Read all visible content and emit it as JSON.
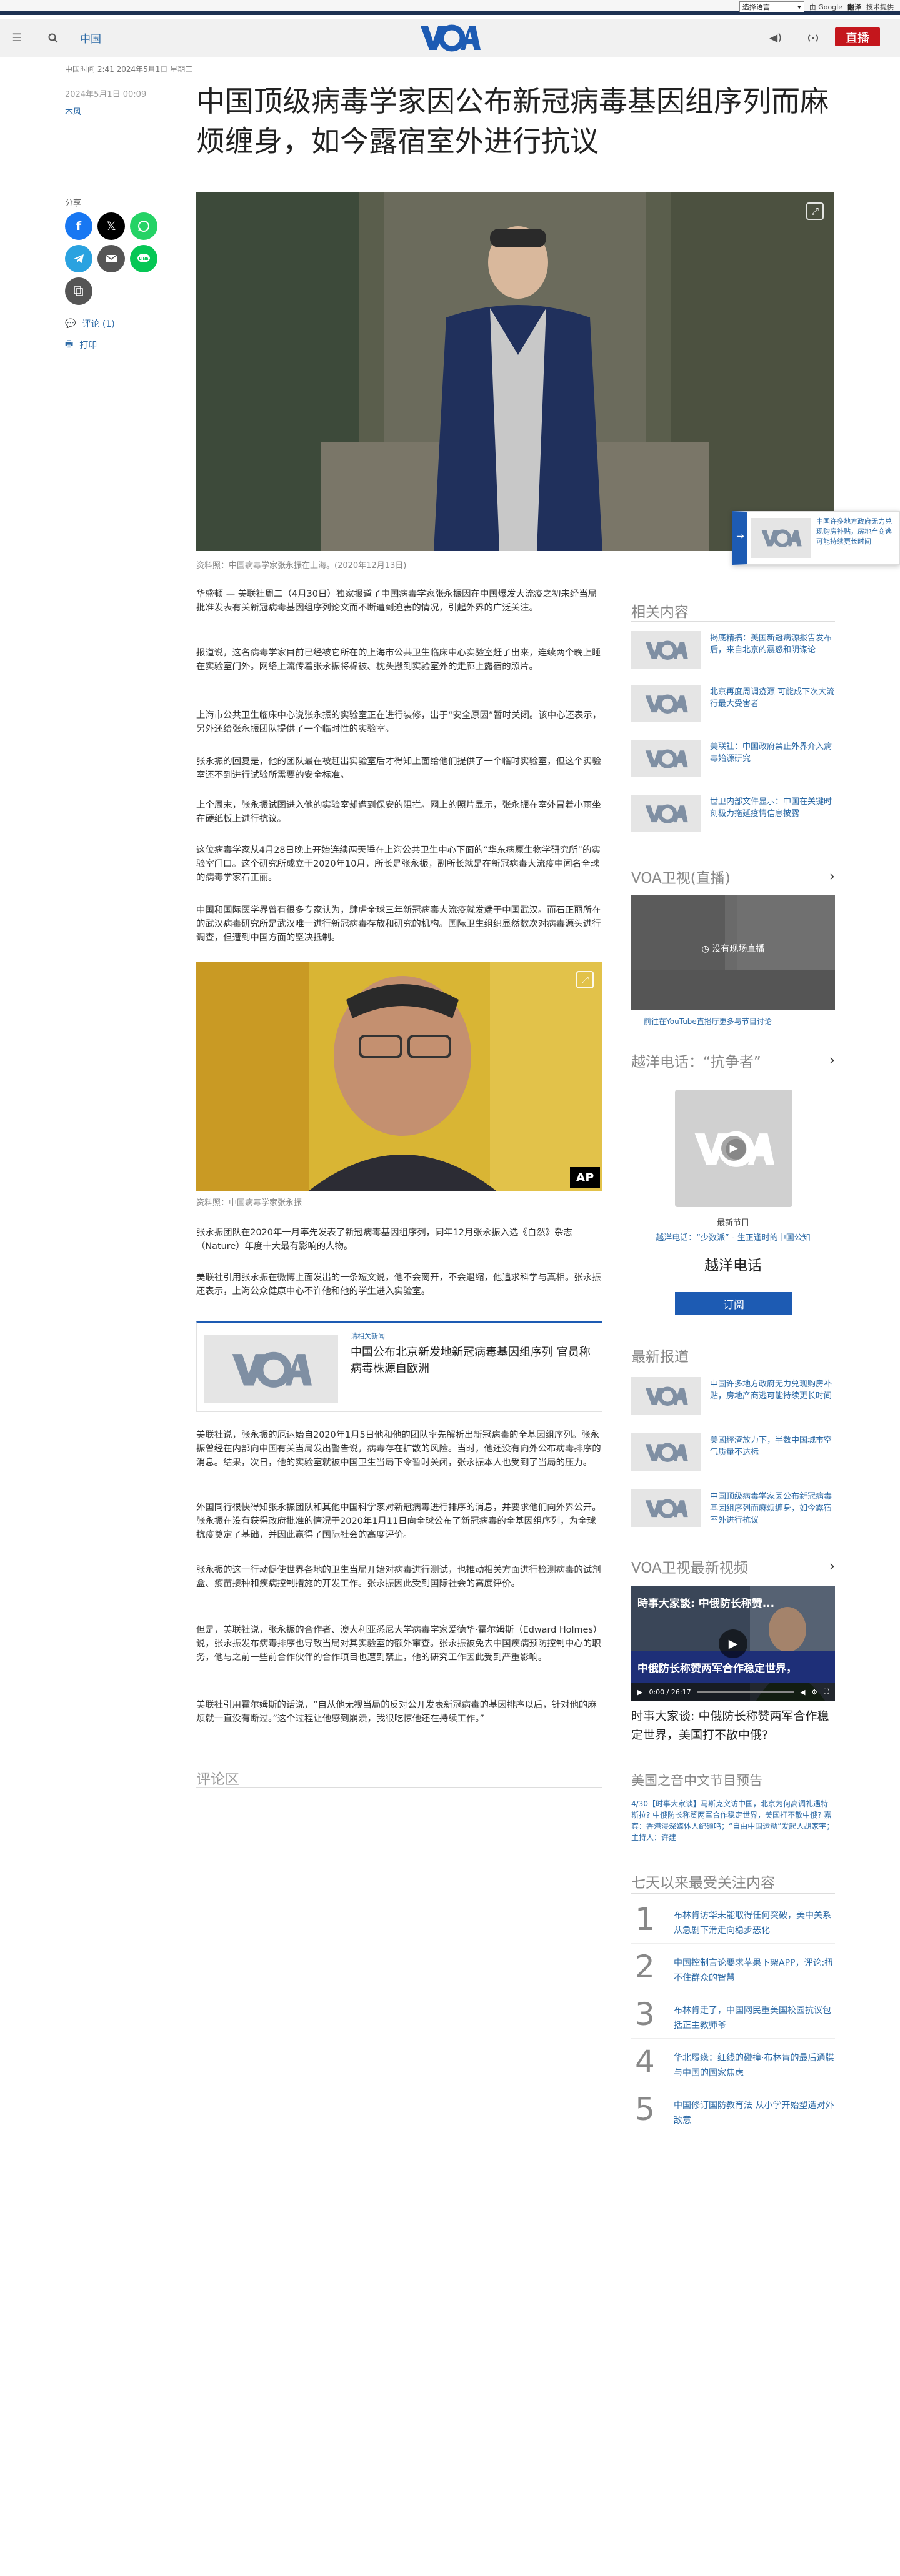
{
  "translate": {
    "select_label": "选择语言",
    "powered_by": "由 Google",
    "translate_word": "翻译",
    "provider": "技术提供"
  },
  "header": {
    "section": "中国",
    "logo_text": "VOA",
    "live_label": "直播",
    "icons": [
      "menu-icon",
      "search-icon",
      "volume-icon",
      "radio-icon"
    ]
  },
  "article": {
    "updated": "中国时间 2:41 2024年5月1日 星期三",
    "date": "2024年5月1日 00:09",
    "author": "木风",
    "title": "中国顶级病毒学家因公布新冠病毒基因组序列而麻烦缠身，如今露宿室外进行抗议",
    "share_label": "分享",
    "comments_link": "评论 (1)",
    "print_link": "打印",
    "photo1_caption": "资料照：中国病毒学家张永振在上海。(2020年12月13日)",
    "photo2_caption": "资料照：中国病毒学家张永振",
    "photo2_badge": "AP",
    "paragraphs_a": [
      "华盛顿 — 美联社周二（4月30日）独家报道了中国病毒学家张永振因在中国爆发大流疫之初未经当局批准发表有关新冠病毒基因组序列论文而不断遭到迫害的情况，引起外界的广泛关注。",
      "报道说，这名病毒学家目前已经被它所在的上海市公共卫生临床中心实验室赶了出来，连续两个晚上睡在实验室门外。网络上流传着张永振将棉被、枕头搬到实验室外的走廊上露宿的照片。",
      "上海市公共卫生临床中心说张永振的实验室正在进行装修，出于“安全原因”暂时关闭。该中心还表示，另外还给张永振团队提供了一个临时性的实验室。",
      "张永振的回复是，他的团队最在被赶出实验室后才得知上面给他们提供了一个临时实验室，但这个实验室还不到进行试验所需要的安全标准。",
      "上个周末，张永振试图进入他的实验室却遭到保安的阻拦。网上的照片显示，张永振在室外冒着小雨坐在硬纸板上进行抗议。",
      "这位病毒学家从4月28日晚上开始连续两天睡在上海公共卫生中心下面的“华东病原生物学研究所”的实验室门口。这个研究所成立于2020年10月，所长是张永振，副所长就是在新冠病毒大流疫中闻名全球的病毒学家石正丽。",
      "中国和国际医学界曾有很多专家认为，肆虐全球三年新冠病毒大流疫就发端于中国武汉。而石正丽所在的武汉病毒研究所是武汉唯一进行新冠病毒存放和研究的机构。国际卫生组织显然数次对病毒源头进行调查，但遭到中国方面的坚决抵制。"
    ],
    "paragraphs_b": [
      "张永振团队在2020年一月率先发表了新冠病毒基因组序列，同年12月张永振入选《自然》杂志（Nature）年度十大最有影响的人物。",
      "美联社引用张永振在微博上面发出的一条短文说，他不会离开，不会退缩，他追求科学与真相。张永振还表示，上海公众健康中心不许他和他的学生进入实验室。"
    ],
    "related_kicker": "请相关新闻",
    "related_title": "中国公布北京新发地新冠病毒基因组序列 官员称病毒株源自欧洲",
    "paragraphs_c": [
      "美联社说，张永振的厄运始自2020年1月5日他和他的团队率先解析出新冠病毒的全基因组序列。张永振曾经在内部向中国有关当局发出警告说，病毒存在扩散的风险。当时，他还没有向外公布病毒排序的消息。结果，次日，他的实验室就被中国卫生当局下令暂时关闭，张永振本人也受到了当局的压力。",
      "外国同行很快得知张永振团队和其他中国科学家对新冠病毒进行排序的消息，并要求他们向外界公开。张永振在没有获得政府批准的情况于2020年1月11日向全球公布了新冠病毒的全基因组序列，为全球抗疫奠定了基础，并因此赢得了国际社会的高度评价。",
      "张永振的这一行动促使世界各地的卫生当局开始对病毒进行测试，也推动相关方面进行检测病毒的试剂盒、疫苗接种和疾病控制措施的开发工作。张永振因此受到国际社会的高度评价。",
      "但是，美联社说，张永振的合作者、澳大利亚悉尼大学病毒学家爱德华·霍尔姆斯（Edward Holmes）说，张永振发布病毒排序也导致当局对其实验室的额外审查。张永振被免去中国疾病预防控制中心的职务，他与之前一些前合作伙伴的合作项目也遭到禁止，他的研究工作因此受到严重影响。",
      "美联社引用霍尔姆斯的话说，“自从他无视当局的反对公开发表新冠病毒的基因排序以后，针对他的麻烦就一直没有断过。”这个过程让他感到崩溃，我很吃惊他还在持续工作。”"
    ],
    "comments_section": "评论区"
  },
  "sidebar": {
    "related_title": "相关内容",
    "related": [
      "揭底精搞：美国新冠病源报告发布后，来自北京的震怒和阴谋论",
      "北京再度周调疫源 可能成下次大流行最大受害者",
      "美联社：中国政府禁止外界介入病毒始源研究",
      "世卫内部文件显示：中国在关键时刻极力拖延疫情信息披露"
    ],
    "live_title": "VOA卫视(直播)",
    "live_status": "没有现场直播",
    "live_link": "前往在YouTube直播厅更多与节目讨论",
    "radio_title": "越洋电话：“抗争者”",
    "radio_latest": "最新节目",
    "radio_episode": "越洋电话：“少数派” - 生正逢时的中国公知",
    "radio_name": "越洋电话",
    "subscribe": "订阅",
    "latest_title": "最新报道",
    "latest": [
      "中国许多地方政府无力兑现购房补贴，房地产商逃可能持续更长时间",
      "美國經濟放力下，半数中国城市空气质量不达标",
      "中国顶级病毒学家因公布新冠病毒基因组序列而麻烦缠身，如今露宿室外进行抗议"
    ],
    "video_title": "VOA卫视最新视频",
    "video_overlay_top": "時事大家談: 中俄防长称赞...",
    "video_overlay_bottom": "中俄防长称赞两军合作稳定世界，",
    "video_time": "0:00 / 26:17",
    "video_caption": "时事大家谈: 中俄防长称赞两军合作稳定世界，美国打不散中俄?",
    "schedule_title": "美国之音中文节目预告",
    "schedule_text": "4/30【时事大家谈】马斯克突访中国，北京为何高调礼遇特斯拉? 中俄防长称赞两军合作稳定世界，美国打不散中俄? 嘉宾：香港浸深媒体人纪硕鸣；“自由中国运动”发起人胡家宇；主持人：许建",
    "popular_title": "七天以来最受关注内容",
    "popular": [
      {
        "num": "1",
        "text": "布林肯访华未能取得任何突破，美中关系从急剧下滑走向稳步恶化"
      },
      {
        "num": "2",
        "text": "中国控制言论要求苹果下架APP，评论:扭不住群众的智慧"
      },
      {
        "num": "3",
        "text": "布林肯走了，中国网民重美国校园抗议包括正主教师爷"
      },
      {
        "num": "4",
        "text": "华北履缘：红线的碰撞·布林肯的最后通牒与中国的国家焦虑"
      },
      {
        "num": "5",
        "text": "中国修订国防教育法 从小学开始塑造对外敌意"
      }
    ]
  },
  "float_card": {
    "text": "中国许多地方政府无力兑现购房补贴，房地产商逃可能持续更长时间"
  },
  "colors": {
    "brand_navy": "#1d3152",
    "link_blue": "#2c6aa6",
    "live_red": "#c4161c"
  }
}
